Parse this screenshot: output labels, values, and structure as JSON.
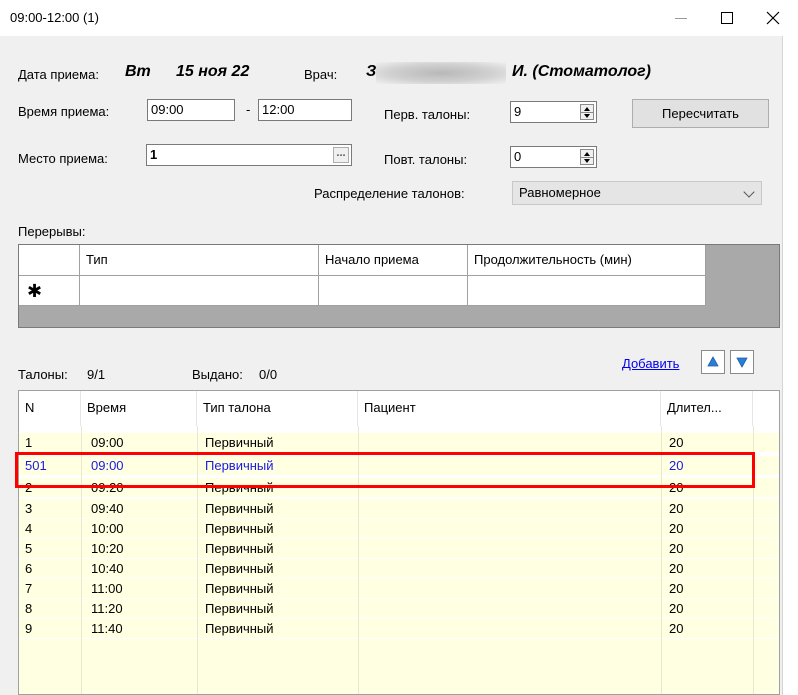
{
  "window": {
    "title": "09:00-12:00 (1)"
  },
  "header": {
    "date_label": "Дата приема:",
    "day_of_week": "Вт",
    "date": "15 ноя 22",
    "doctor_label": "Врач:",
    "doctor_initial": "З",
    "doctor_suffix": "И. (Стоматолог)"
  },
  "form": {
    "time_label": "Время приема:",
    "time_from": "09:00",
    "time_sep": "-",
    "time_to": "12:00",
    "place_label": "Место приема:",
    "place_value": "1",
    "place_browse": "...",
    "first_tickets_label": "Перв. талоны:",
    "first_tickets_value": "9",
    "repeat_tickets_label": "Повт. талоны:",
    "repeat_tickets_value": "0",
    "recalc_button": "Пересчитать",
    "distribution_label": "Распределение талонов:",
    "distribution_value": "Равномерное"
  },
  "breaks": {
    "label": "Перерывы:",
    "columns": [
      "Тип",
      "Начало приема",
      "Продолжительность (мин)"
    ],
    "new_row_marker": "✱"
  },
  "tickets": {
    "count_label": "Талоны:",
    "count_value": "9/1",
    "issued_label": "Выдано:",
    "issued_value": "0/0",
    "add_link": "Добавить",
    "columns": [
      "N",
      "Время",
      "Тип талона",
      "Пациент",
      "Длител..."
    ],
    "rows": [
      {
        "n": "1",
        "time": "09:00",
        "type": "Первичный",
        "patient": "",
        "duration": "20"
      },
      {
        "n": "501",
        "time": "09:00",
        "type": "Первичный",
        "patient": "",
        "duration": "20"
      },
      {
        "n": "2",
        "time": "09:20",
        "type": "Первичный",
        "patient": "",
        "duration": "20"
      },
      {
        "n": "3",
        "time": "09:40",
        "type": "Первичный",
        "patient": "",
        "duration": "20"
      },
      {
        "n": "4",
        "time": "10:00",
        "type": "Первичный",
        "patient": "",
        "duration": "20"
      },
      {
        "n": "5",
        "time": "10:20",
        "type": "Первичный",
        "patient": "",
        "duration": "20"
      },
      {
        "n": "6",
        "time": "10:40",
        "type": "Первичный",
        "patient": "",
        "duration": "20"
      },
      {
        "n": "7",
        "time": "11:00",
        "type": "Первичный",
        "patient": "",
        "duration": "20"
      },
      {
        "n": "8",
        "time": "11:20",
        "type": "Первичный",
        "patient": "",
        "duration": "20"
      },
      {
        "n": "9",
        "time": "11:40",
        "type": "Первичный",
        "patient": "",
        "duration": "20"
      }
    ]
  },
  "colors": {
    "row_background": "#ffffe1",
    "selected_text": "#1a1ae6",
    "highlight_border": "#ff0000",
    "link": "#0000ee"
  }
}
